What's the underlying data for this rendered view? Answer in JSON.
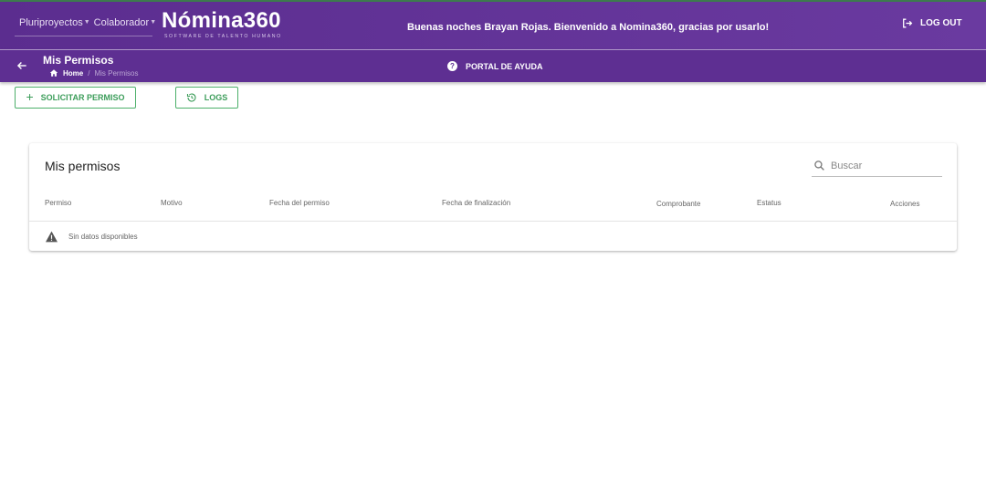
{
  "header": {
    "company_selector": "Pluriproyectos",
    "role_selector": "Colaborador",
    "logo_name": "Nómina360",
    "logo_tagline": "SOFTWARE DE TALENTO HUMANO",
    "greeting": "Buenas noches Brayan Rojas. Bienvenido a Nomina360, gracias por usarlo!",
    "logout_label": "LOG OUT"
  },
  "subheader": {
    "page_title": "Mis Permisos",
    "breadcrumb_home": "Home",
    "breadcrumb_separator": "/",
    "breadcrumb_current": "Mis Permisos",
    "help_label": "PORTAL DE AYUDA"
  },
  "actions": {
    "request_label": "SOLICITAR PERMISO",
    "logs_label": "LOGS"
  },
  "table": {
    "title": "Mis permisos",
    "search_placeholder": "Buscar",
    "columns": [
      "Permiso",
      "Motivo",
      "Fecha del permiso",
      "Fecha de finalización",
      "Comprobante",
      "Estatus",
      "Acciones"
    ],
    "empty_message": "Sin datos disponibles"
  },
  "colors": {
    "brand_purple": "#5e2f92",
    "accent_green": "#4caf6a"
  }
}
